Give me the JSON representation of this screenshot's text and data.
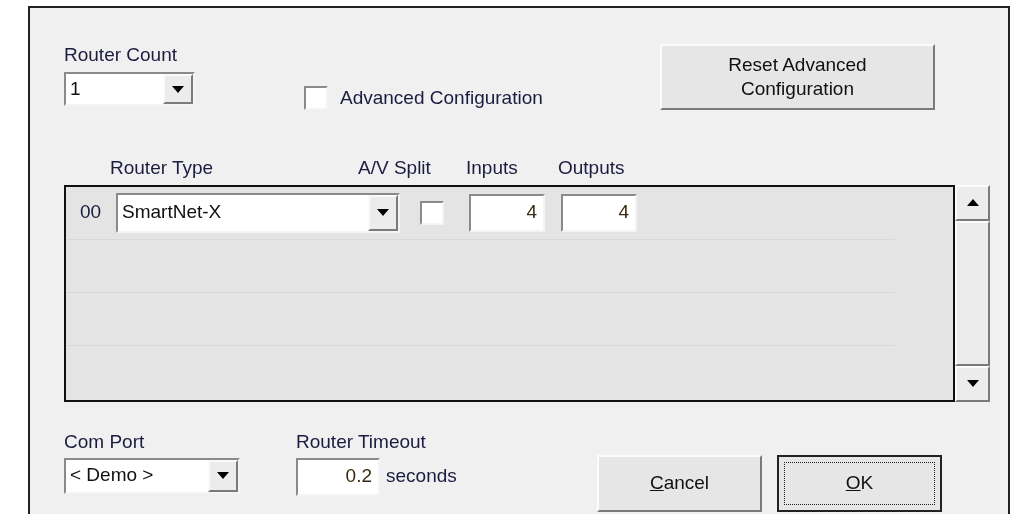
{
  "router_count": {
    "label": "Router Count",
    "value": "1"
  },
  "advanced_configuration": {
    "label": "Advanced Configuration",
    "checked": false
  },
  "reset_button": {
    "lines": [
      "Reset Advanced",
      "Configuration"
    ]
  },
  "columns": [
    "Router Type",
    "A/V Split",
    "Inputs",
    "Outputs"
  ],
  "routers": [
    {
      "index": "00",
      "type": "SmartNet-X",
      "av_split": false,
      "inputs": "4",
      "outputs": "4"
    }
  ],
  "com_port": {
    "label": "Com Port",
    "value": "< Demo >"
  },
  "router_timeout": {
    "label": "Router Timeout",
    "value": "0.2",
    "unit": "seconds"
  },
  "buttons": [
    {
      "label": "Cancel",
      "default": false,
      "access_key_first": true
    },
    {
      "label": "OK",
      "default": true,
      "access_key_first": true
    }
  ]
}
